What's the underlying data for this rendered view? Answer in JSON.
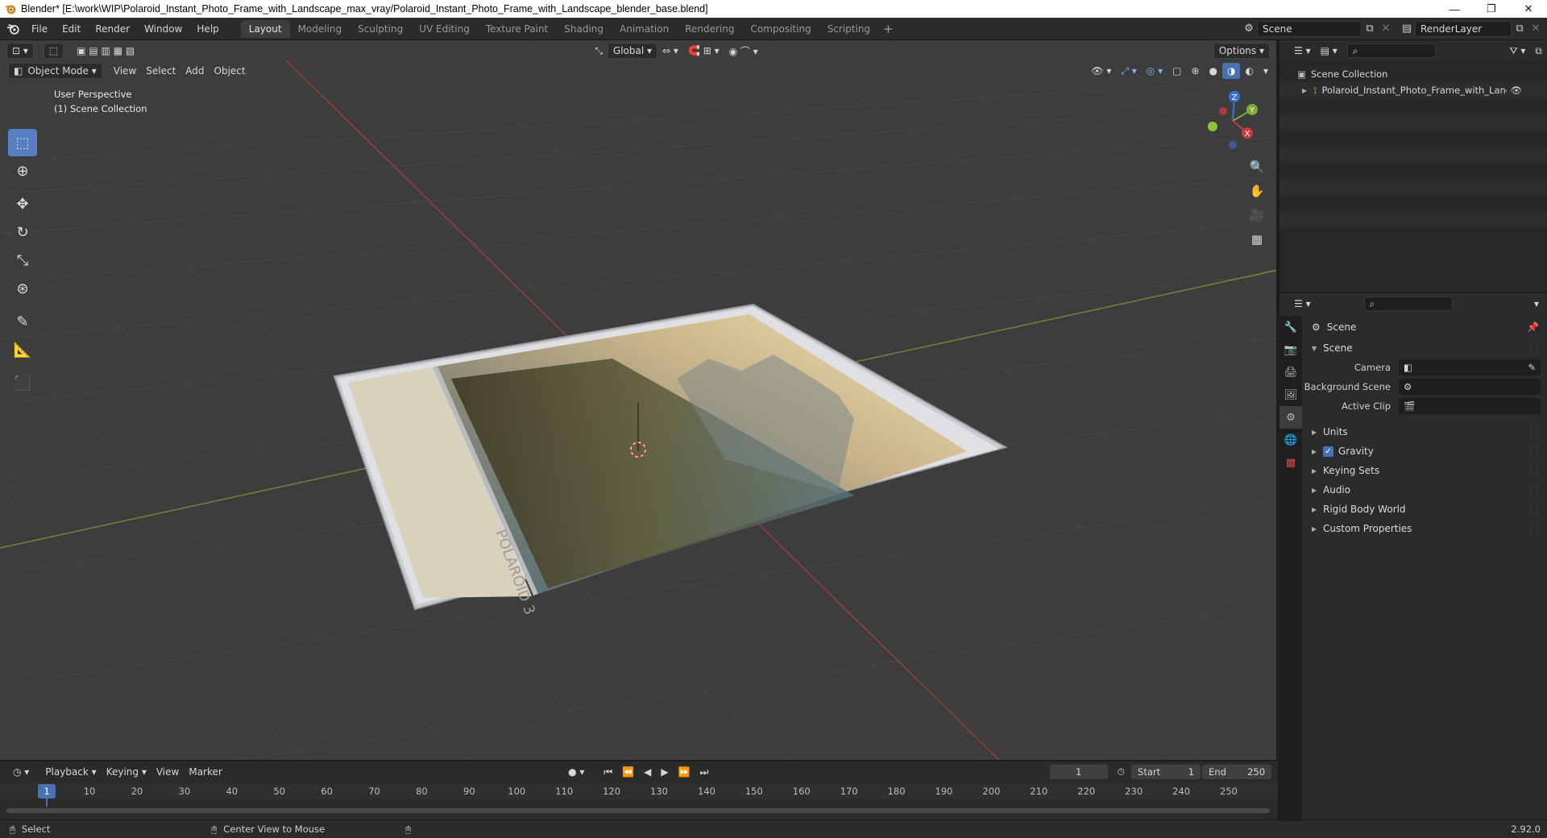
{
  "window": {
    "title": "Blender* [E:\\work\\WIP\\Polaroid_Instant_Photo_Frame_with_Landscape_max_vray/Polaroid_Instant_Photo_Frame_with_Landscape_blender_base.blend]",
    "minimize": "—",
    "maximize": "❐",
    "close": "✕"
  },
  "menu": {
    "items": [
      "File",
      "Edit",
      "Render",
      "Window",
      "Help"
    ]
  },
  "workspaces": {
    "tabs": [
      "Layout",
      "Modeling",
      "Sculpting",
      "UV Editing",
      "Texture Paint",
      "Shading",
      "Animation",
      "Rendering",
      "Compositing",
      "Scripting"
    ],
    "active": "Layout",
    "add": "+"
  },
  "scene_selector": {
    "value": "Scene"
  },
  "view_layer": {
    "value": "RenderLayer"
  },
  "viewport": {
    "mode": "Object Mode",
    "menus": [
      "View",
      "Select",
      "Add",
      "Object"
    ],
    "transform_orientation": "Global",
    "options_label": "Options",
    "perspective_label": "User Perspective",
    "collection_label": "(1) Scene Collection",
    "gizmo_axes": {
      "x": "X",
      "y": "Y",
      "z": "Z"
    }
  },
  "photo_frame": {
    "brand_text": "POLAROID 3"
  },
  "timeline": {
    "menus": [
      "Playback",
      "Keying",
      "View",
      "Marker"
    ],
    "current_frame": "1",
    "start_label": "Start",
    "start_value": "1",
    "end_label": "End",
    "end_value": "250",
    "ruler_marks": [
      "1",
      "10",
      "20",
      "30",
      "40",
      "50",
      "60",
      "70",
      "80",
      "90",
      "100",
      "110",
      "120",
      "130",
      "140",
      "150",
      "160",
      "170",
      "180",
      "190",
      "200",
      "210",
      "220",
      "230",
      "240",
      "250"
    ]
  },
  "statusbar": {
    "select_label": "Select",
    "center_view_label": "Center View to Mouse",
    "version": "2.92.0"
  },
  "outliner": {
    "root": "Scene Collection",
    "object": "Polaroid_Instant_Photo_Frame_with_Landsca"
  },
  "properties": {
    "context_title": "Scene",
    "panel_title": "Scene",
    "fields": [
      {
        "label": "Camera",
        "value": ""
      },
      {
        "label": "Background Scene",
        "value": ""
      },
      {
        "label": "Active Clip",
        "value": ""
      }
    ],
    "panels": [
      "Units",
      "Gravity",
      "Keying Sets",
      "Audio",
      "Rigid Body World",
      "Custom Properties"
    ],
    "gravity_checked": true
  },
  "colors": {
    "accent": "#4772b3",
    "viewport_bg": "#3d3d3d",
    "x_axis": "#c83b3b",
    "y_axis": "#7fa83b",
    "z_axis": "#3b6fd6"
  }
}
